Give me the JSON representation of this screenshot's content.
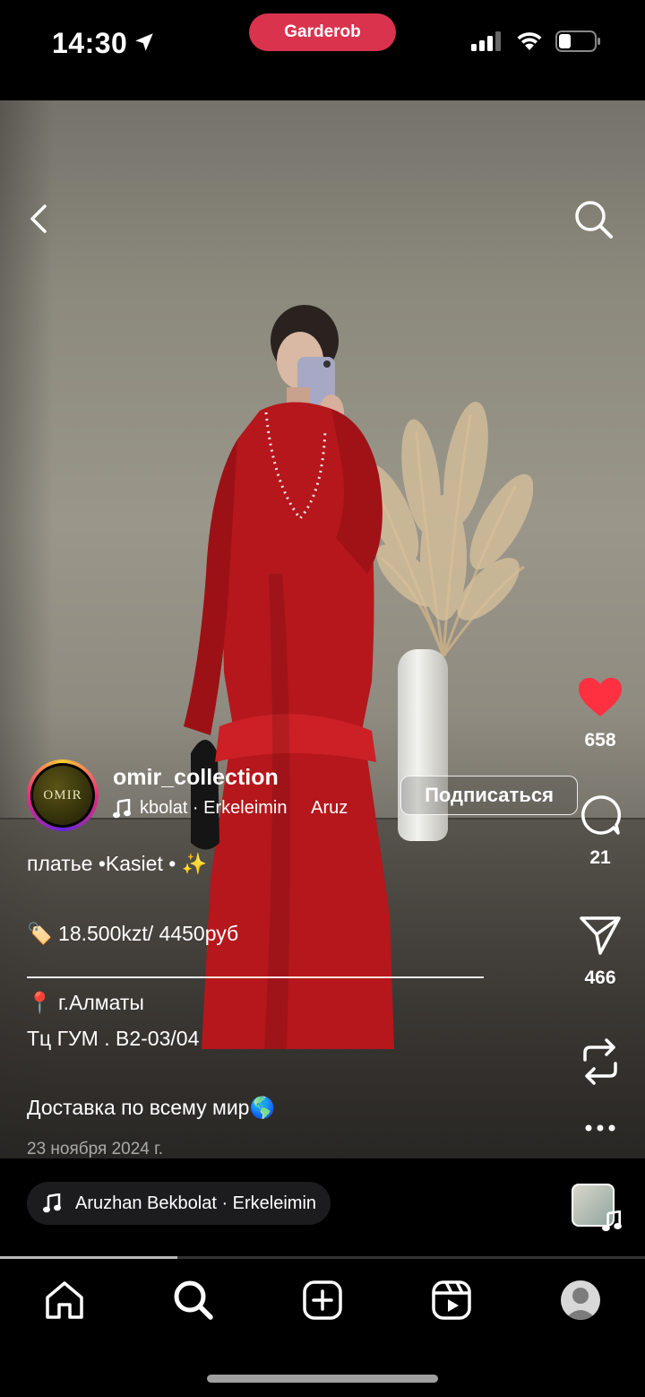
{
  "status_bar": {
    "time": "14:30",
    "app_pill": "Garderob"
  },
  "post": {
    "username": "omir_collection",
    "avatar_text": "OMIR",
    "music_scroll": "kbolat · Erkeleimin     Aruz",
    "subscribe_label": "Подписаться",
    "likes": "658",
    "comments": "21",
    "shares": "466",
    "caption": {
      "line1": "платье •Kasiet • ✨",
      "price": "🏷️ 18.500kzt/ 4450руб",
      "location": "📍 г.Алматы",
      "address": "Тц ГУМ .  B2-03/04",
      "delivery": "Доставка по всему мир🌎"
    },
    "date": "23 ноября 2024 г."
  },
  "audio": {
    "track": "Aruzhan Bekbolat · Erkeleimin"
  },
  "playback": {
    "progress": 0.275
  },
  "colors": {
    "pill": "#d9334e",
    "like_heart": "#ff3040",
    "dress": "#b5171c"
  },
  "icons": {
    "nav": [
      "home-icon",
      "search-icon",
      "create-icon",
      "reels-icon",
      "profile-icon"
    ],
    "actions": [
      "heart-icon",
      "comment-icon",
      "share-icon",
      "remix-icon",
      "more-icon"
    ]
  }
}
